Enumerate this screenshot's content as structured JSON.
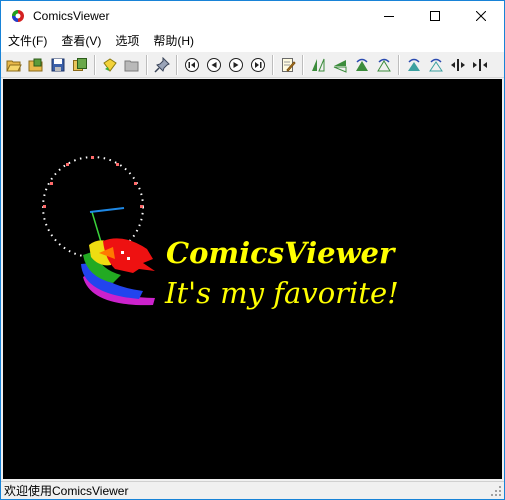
{
  "window": {
    "title": "ComicsViewer"
  },
  "menu": [
    {
      "id": "file",
      "label": "文件(F)"
    },
    {
      "id": "view",
      "label": "查看(V)"
    },
    {
      "id": "options",
      "label": "选项"
    },
    {
      "id": "help",
      "label": "帮助(H)"
    }
  ],
  "toolbar": {
    "buttons": [
      "open-folder-icon",
      "open-archive-icon",
      "save-icon",
      "copy-icon",
      "add-bookmark-icon",
      "bookmark-folder-icon",
      "pin-icon",
      "first-page-icon",
      "previous-page-icon",
      "next-page-icon",
      "last-page-icon",
      "edit-icon",
      "rotate-left-icon",
      "rotate-right-icon",
      "flip-left-icon",
      "flip-right-icon",
      "mirror-left-icon",
      "mirror-right-icon",
      "fit-width-icon",
      "fit-height-icon"
    ]
  },
  "splash": {
    "title": "ComicsViewer",
    "slogan": "It's my favorite!",
    "title_color": "#ffff00"
  },
  "status": {
    "text": "欢迎使用ComicsViewer"
  }
}
